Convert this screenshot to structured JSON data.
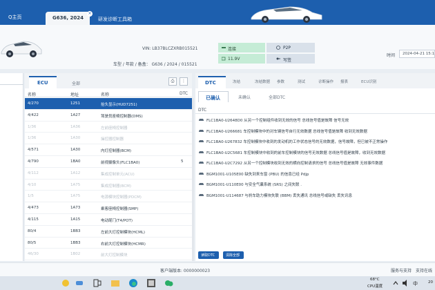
{
  "topbar": {
    "home_label": "Q主页",
    "active_tab_label": "G636, 2024",
    "close_glyph": "×",
    "second_tab_label": "研发诊断工具箱"
  },
  "header": {
    "vin": "VIN: LB37BLCZXRB015521",
    "model": "车型 / 年款 / 备盒：  G636 / 2024 / 015521",
    "status": {
      "r1_left": "连接",
      "r1_right": "P2P",
      "r2_left": "11.9V",
      "r2_right": "写签"
    },
    "date_label": "时间",
    "date_value": "2024-04-21 15:18"
  },
  "ecu": {
    "tab_active": "ECU",
    "tab_other": "全部",
    "columns": {
      "name": "名称",
      "address": "地址",
      "desc": "名称",
      "dtc": "DTC"
    },
    "rows": [
      {
        "name": "4/270",
        "addr": "1251",
        "desc": "抬头显示(HUD7251)",
        "dtc": "",
        "state": "selected"
      },
      {
        "name": "4/422",
        "addr": "1A27",
        "desc": "驾驶员座椅控制器(DMS)",
        "dtc": "",
        "state": "normal"
      },
      {
        "name": "1/36",
        "addr": "1A36",
        "desc": "左前座椅控制器",
        "dtc": "",
        "state": "dim"
      },
      {
        "name": "1/36",
        "addr": "1A30",
        "desc": "操控器控制器",
        "dtc": "",
        "state": "dim"
      },
      {
        "name": "4/571",
        "addr": "1A30",
        "desc": "内灯控制器(BCM)",
        "dtc": "",
        "state": "normal"
      },
      {
        "name": "4/790",
        "addr": "1BA0",
        "desc": "前视摄像头(FLC1BA0)",
        "dtc": "5",
        "state": "normal"
      },
      {
        "name": "4/112",
        "addr": "1A12",
        "desc": "集成控制单元(ACU)",
        "dtc": "",
        "state": "dim"
      },
      {
        "name": "4/10",
        "addr": "1A75",
        "desc": "集成控制器(BCM)",
        "dtc": "",
        "state": "dim"
      },
      {
        "name": "1/5",
        "addr": "1A75",
        "desc": "电源模块控制器(PDCM)",
        "dtc": "",
        "state": "dim"
      },
      {
        "name": "4/473",
        "addr": "1A73",
        "desc": "乘客座椅控制器(SMP)",
        "dtc": "",
        "state": "normal"
      },
      {
        "name": "4/115",
        "addr": "1A15",
        "desc": "电动尾门(T4/POT)",
        "dtc": "",
        "state": "normal"
      },
      {
        "name": "80/4",
        "addr": "1BB3",
        "desc": "左前大灯控制模块(HCML)",
        "dtc": "",
        "state": "normal"
      },
      {
        "name": "80/5",
        "addr": "1BB3",
        "desc": "右前大灯控制模块(HCMR)",
        "dtc": "",
        "state": "normal"
      },
      {
        "name": "46/30",
        "addr": "1B02",
        "desc": "前大灯控制模块",
        "dtc": "",
        "state": "dim"
      }
    ]
  },
  "dtc": {
    "tabs": [
      "DTC",
      "冻结",
      "冻结数据",
      "参数",
      "测试",
      "诊断操作",
      "报表",
      "ECU识别"
    ],
    "subtabs": [
      "已确认",
      "未确认",
      "全部DTC"
    ],
    "column": "DTC",
    "rows": [
      "FLC1BA0-U2648D0 从另一个控制组件收到无效的信号 总线信号值是故障 信号无效",
      "FLC1BA0-U266681 车控制模块中的对车辆信号自行无效数据 总线信号值是故障 收到无效数据",
      "FLC1BA0-U267832 车控制模块中收到的发动机的工作状态信号的无效数据，信号故障，但已被不正常操作",
      "FLC1BA0-U2C5681 车控制模块中收到的前车控制模块的信号无效数据 总线信号值是故障，收到无效数据",
      "FLC1BA0-U2C7292 从另一个控制模块收到无效的横向控制请求的信号 总线信号值是故障 无效事件数据",
      "BGM1001-U105E00 缺失到来车窗 (PBU) 的信息已经 Pdjp",
      "BGM1001-U110E00 与安全气囊系统 (SRS) 之间失联 .",
      "BGM1001-U114687 与刹车助力模块失联 (BBM) 丢失通讯 总线信号或缺失 丢失讯息"
    ],
    "btn_left": "读取DTC",
    "btn_right": "清除全部"
  },
  "statusbar": {
    "left": "客户端版本: 0000000023",
    "right1": "服务与支持",
    "right2": "支持在线"
  },
  "taskbar": {
    "temp": "68°C",
    "cpu": "CPU温度",
    "ime": "中",
    "clock": "20"
  }
}
